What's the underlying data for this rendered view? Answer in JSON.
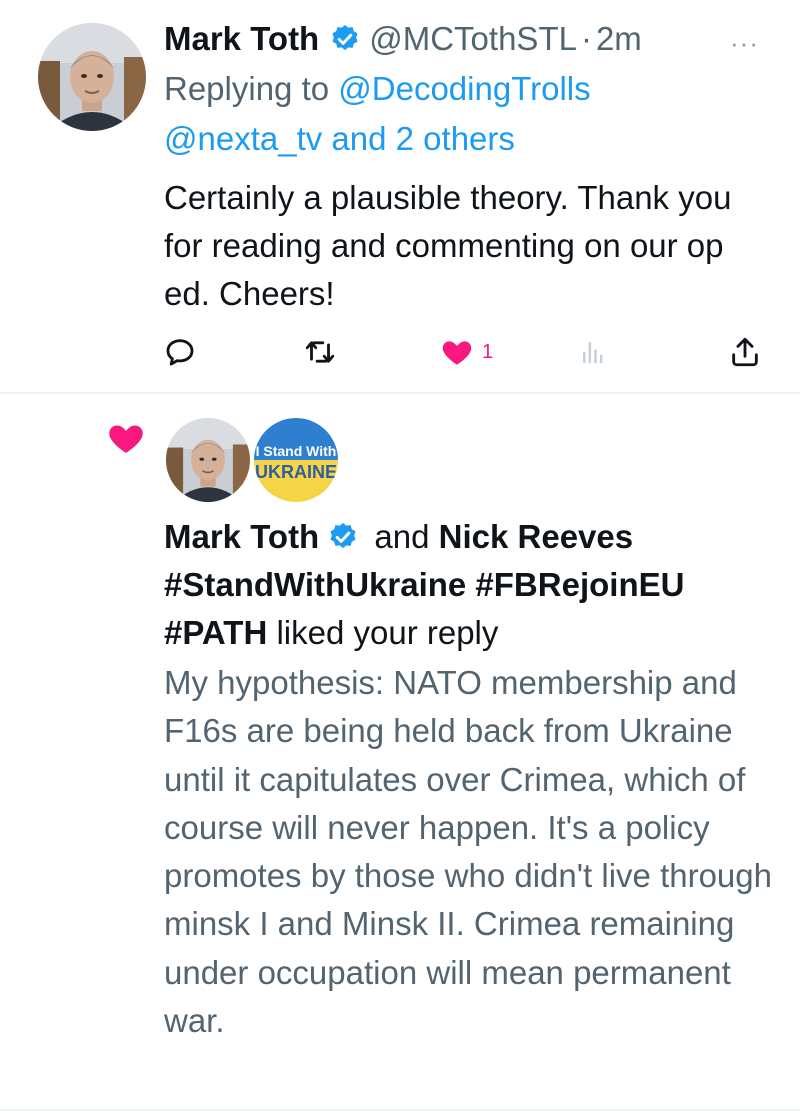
{
  "tweet": {
    "author_name": "Mark Toth",
    "handle": "@MCTothSTL",
    "separator": "·",
    "time": "2m",
    "more_label": "···",
    "replying_prefix": "Replying to ",
    "replying_user": "@DecodingTrolls",
    "replying_others": "@nexta_tv and 2 others",
    "text": "Certainly a plausible theory. Thank you for reading and commenting on our op ed. Cheers!",
    "actions": {
      "reply_icon": "reply-icon",
      "retweet_icon": "retweet-icon",
      "like_icon": "heart-icon",
      "like_count": "1",
      "views_icon": "views-icon",
      "share_icon": "share-icon"
    }
  },
  "notification": {
    "icon": "heart-icon",
    "badge_line1": "I Stand With",
    "badge_line2": "UKRAINE",
    "liker1": "Mark Toth",
    "and": " and ",
    "liker2": "Nick Reeves #StandWithUkraine #FBRejoinEU #PATH",
    "action": " liked your reply",
    "reply_text": "My hypothesis: NATO membership and F16s are being held back from Ukraine until it capitulates over Crimea, which of course will never happen. It's a policy promotes by those who didn't live through minsk I and Minsk II. Crimea remaining under occupation will mean permanent war."
  },
  "colors": {
    "link": "#1d9bf0",
    "like": "#f91880",
    "secondary_text": "#536471",
    "primary_text": "#0f1419",
    "ukraine_blue": "#2f7fd1",
    "ukraine_yellow": "#f5d547"
  }
}
